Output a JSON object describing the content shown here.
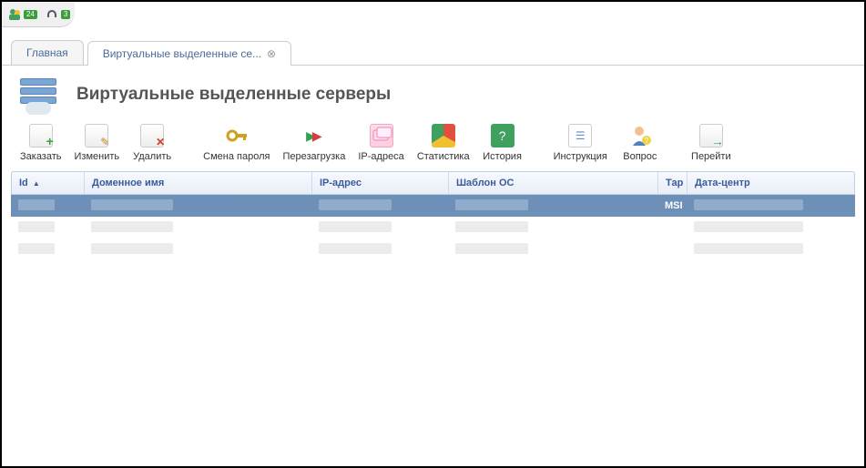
{
  "top": {
    "badge1": "24",
    "badge2": "3"
  },
  "tabs": {
    "main": "Главная",
    "vds": "Виртуальные выделенные се..."
  },
  "page_title": "Виртуальные выделенные серверы",
  "toolbar": {
    "order": "Заказать",
    "edit": "Изменить",
    "delete": "Удалить",
    "password": "Смена пароля",
    "reboot": "Перезагрузка",
    "ips": "IP-адреса",
    "stats": "Статистика",
    "history": "История",
    "instruction": "Инструкция",
    "question": "Вопрос",
    "go": "Перейти"
  },
  "columns": {
    "id": "Id",
    "domain": "Доменное имя",
    "ip": "IP-адрес",
    "os": "Шаблон ОС",
    "tariff": "Тар",
    "dc": "Дата-центр"
  },
  "rows": [
    {
      "id": "",
      "domain": "",
      "ip": "",
      "os": "",
      "tariff": "MSI",
      "dc": "",
      "selected": true
    },
    {
      "id": "",
      "domain": "",
      "ip": "",
      "os": "",
      "tariff": "",
      "dc": "",
      "selected": false
    },
    {
      "id": "",
      "domain": "",
      "ip": "",
      "os": "",
      "tariff": "",
      "dc": "",
      "selected": false
    }
  ]
}
